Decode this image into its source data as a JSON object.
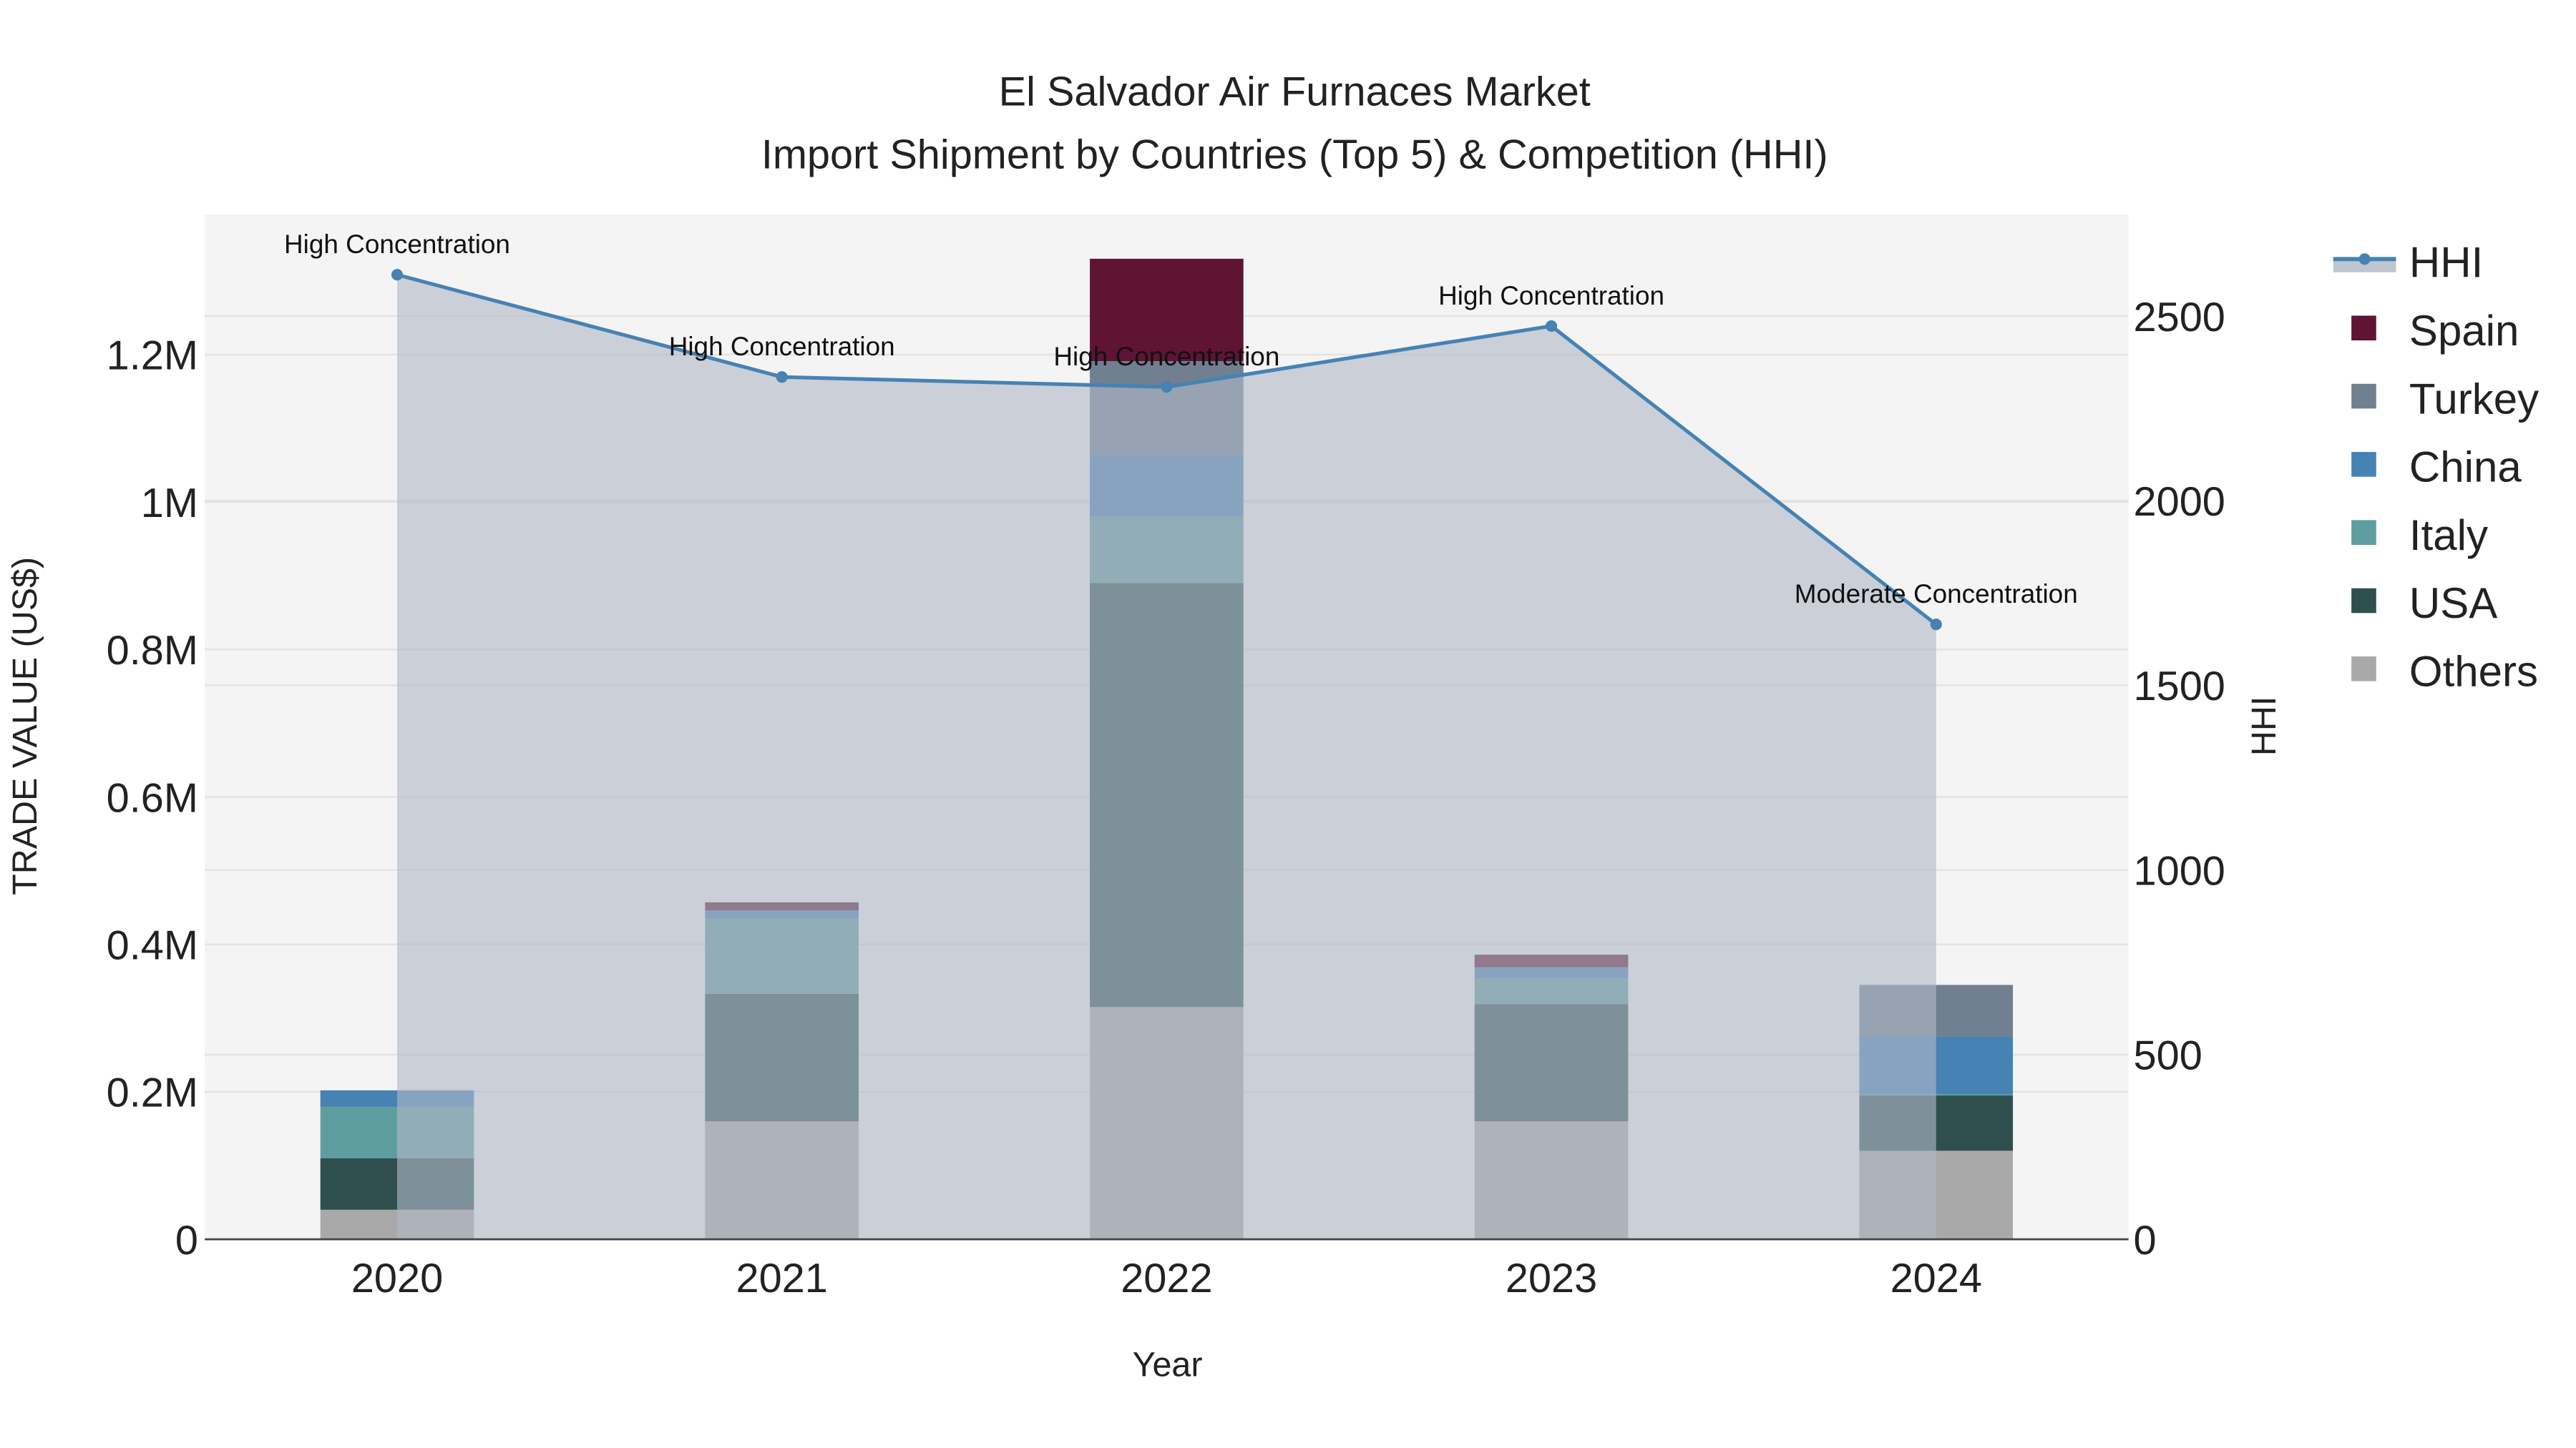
{
  "chart_data": {
    "type": "bar",
    "title": "El Salvador Air Furnaces Market",
    "subtitle": "Import Shipment by Countries (Top 5) & Competition (HHI)",
    "xlabel": "Year",
    "ylabel": "TRADE VALUE (US$)",
    "y2label": "HHI",
    "categories": [
      "2020",
      "2021",
      "2022",
      "2023",
      "2024"
    ],
    "ylim": [
      0,
      1390000
    ],
    "y2lim": [
      0,
      2775
    ],
    "yticks": [
      0,
      200000,
      400000,
      600000,
      800000,
      1000000,
      1200000
    ],
    "ytick_labels": [
      "0",
      "0.2M",
      "0.4M",
      "0.6M",
      "0.8M",
      "1M",
      "1.2M"
    ],
    "y2ticks": [
      0,
      500,
      1000,
      1500,
      2000,
      2500
    ],
    "y2tick_labels": [
      "0",
      "500",
      "1000",
      "1500",
      "2000",
      "2500"
    ],
    "stacking": "stacked",
    "series": [
      {
        "name": "Others",
        "color": "#a9a9a9",
        "values": [
          40000,
          160000,
          315000,
          160000,
          120000
        ]
      },
      {
        "name": "USA",
        "color": "#2f4f4f",
        "values": [
          70000,
          173000,
          575000,
          159000,
          75000
        ]
      },
      {
        "name": "Italy",
        "color": "#5f9ea0",
        "values": [
          70000,
          102000,
          90000,
          35000,
          2000
        ]
      },
      {
        "name": "China",
        "color": "#4682b4",
        "values": [
          22000,
          11000,
          83000,
          15000,
          78000
        ]
      },
      {
        "name": "Turkey",
        "color": "#708090",
        "values": [
          0,
          0,
          128000,
          0,
          70000
        ]
      },
      {
        "name": "Spain",
        "color": "#5f1434",
        "values": [
          0,
          11000,
          139000,
          17000,
          0
        ]
      }
    ],
    "hhi": {
      "name": "HHI",
      "color": "#4682b4",
      "values": [
        2612,
        2335,
        2308,
        2473,
        1665
      ],
      "annotations": [
        "High Concentration",
        "High Concentration",
        "High Concentration",
        "High Concentration",
        "Moderate Concentration"
      ]
    },
    "legend_order": [
      "HHI",
      "Spain",
      "Turkey",
      "China",
      "Italy",
      "USA",
      "Others"
    ],
    "legend_position": "right",
    "grid": true
  }
}
